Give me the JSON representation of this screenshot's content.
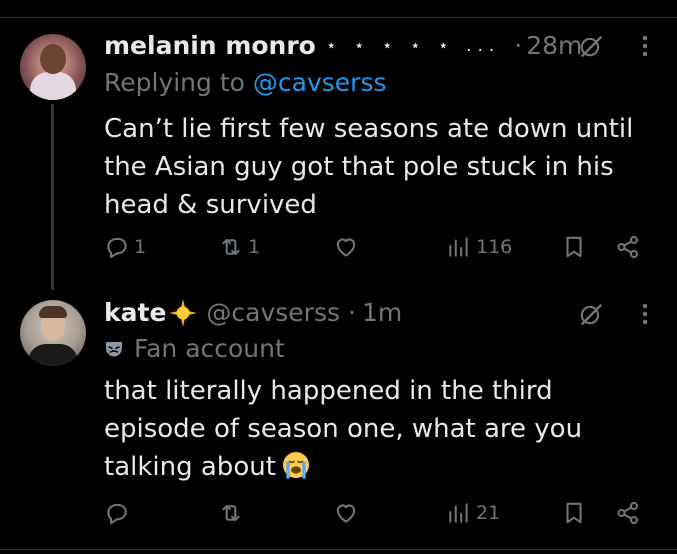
{
  "tweets": [
    {
      "display_name": "melanin monro",
      "name_decoration": "⋆ ⋆ ⋆ ⋆ ⋆ ...",
      "separator": "·",
      "time": "28m",
      "replying_prefix": "Replying to",
      "replying_handle": "@cavserss",
      "text": "Can’t lie first few seasons ate down until\nthe Asian guy got that pole stuck in his\nhead & survived",
      "replies": "1",
      "reposts": "1",
      "likes": "",
      "views": "116"
    },
    {
      "display_name": "kate",
      "name_emoji": "sun-with-sparkle",
      "handle": "@cavserss",
      "separator": "·",
      "time": "1m",
      "badge_icon": "mask-icon",
      "badge_text": "Fan account",
      "text": "that literally happened in the third\nepisode of season one, what are you\ntalking about",
      "text_emoji": "loudly-crying-face",
      "replies": "",
      "reposts": "",
      "likes": "",
      "views": "21"
    }
  ],
  "colors": {
    "background": "#000000",
    "text": "#e7e9ea",
    "secondary": "#71767b",
    "link": "#1d9bf0",
    "divider": "#2f3336"
  }
}
